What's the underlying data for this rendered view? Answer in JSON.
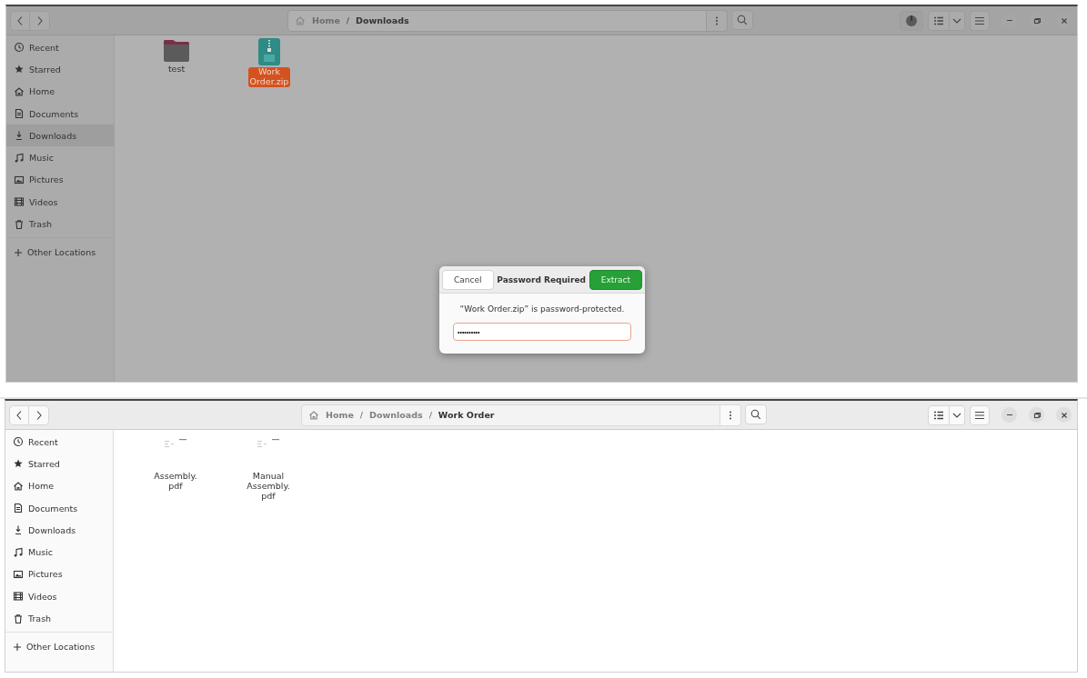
{
  "windows": [
    {
      "dimmed": true,
      "operations_button": true,
      "path": [
        {
          "label": "Home",
          "current": false
        },
        {
          "separator": "/",
          "label": "Downloads",
          "current": true
        }
      ],
      "sidebar": [
        {
          "label": "Recent",
          "selected": false
        },
        {
          "label": "Starred",
          "selected": false
        },
        {
          "label": "Home",
          "selected": false
        },
        {
          "label": "Documents",
          "selected": false
        },
        {
          "label": "Downloads",
          "selected": true
        },
        {
          "label": "Music",
          "selected": false
        },
        {
          "label": "Pictures",
          "selected": false
        },
        {
          "label": "Videos",
          "selected": false
        },
        {
          "label": "Trash",
          "selected": false
        }
      ],
      "other_locations": "Other Locations",
      "files": [
        {
          "kind": "folder",
          "name": "test",
          "selected": false
        },
        {
          "kind": "zip",
          "name": "Work\nOrder.zip",
          "selected": true
        }
      ],
      "dialog": {
        "cancel": "Cancel",
        "title": "Password Required",
        "confirm": "Extract",
        "message": "“Work Order.zip” is password-protected.",
        "password": "••••••••••"
      }
    },
    {
      "dimmed": false,
      "path": [
        {
          "label": "Home",
          "current": false
        },
        {
          "separator": "/",
          "label": "Downloads",
          "current": false
        },
        {
          "separator": "/",
          "label": "Work Order",
          "current": true
        }
      ],
      "sidebar": [
        {
          "label": "Recent",
          "selected": false
        },
        {
          "label": "Starred",
          "selected": false
        },
        {
          "label": "Home",
          "selected": false
        },
        {
          "label": "Documents",
          "selected": false
        },
        {
          "label": "Downloads",
          "selected": false
        },
        {
          "label": "Music",
          "selected": false
        },
        {
          "label": "Pictures",
          "selected": false
        },
        {
          "label": "Videos",
          "selected": false
        },
        {
          "label": "Trash",
          "selected": false
        }
      ],
      "other_locations": "Other Locations",
      "files": [
        {
          "kind": "pdf",
          "name": "Assembly.\npdf",
          "selected": false
        },
        {
          "kind": "pdf",
          "name": "Manual\nAssembly.\npdf",
          "selected": false
        }
      ]
    }
  ]
}
